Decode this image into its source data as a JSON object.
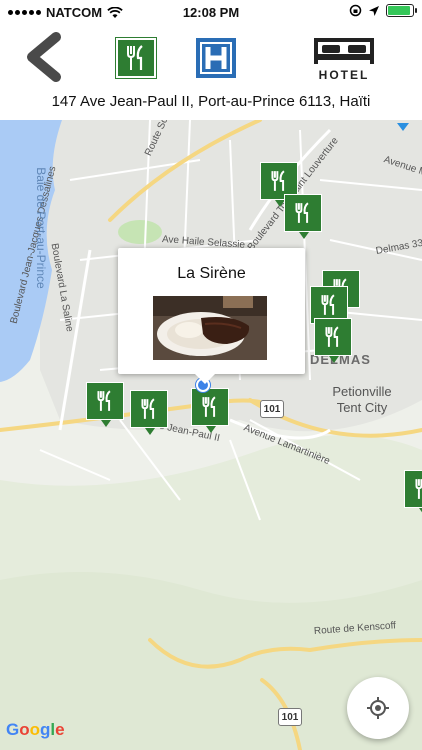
{
  "status_bar": {
    "carrier": "NATCOM",
    "time": "12:08 PM",
    "battery_level": 0.9
  },
  "nav": {
    "back_icon": "chevron-left-icon",
    "categories": [
      {
        "name": "restaurants",
        "icon": "fork-knife-icon",
        "color": "#2e7d32"
      },
      {
        "name": "hospitals",
        "icon": "hospital-h-icon",
        "color": "#2a6db5"
      },
      {
        "name": "hotels",
        "icon": "bed-icon",
        "label": "HOTEL"
      }
    ]
  },
  "address": "147 Ave Jean-Paul II, Port-au-Prince 6113, Haïti",
  "map": {
    "road_labels": [
      "Route Soleil",
      "Boulevard La Saline",
      "Boulevard Jean-Jacques Dessalines",
      "Ave Haile Selassie",
      "Boulevard Toussaint Louverture",
      "Avenue M",
      "Delmas 33",
      "Ave Jean-Paul II",
      "Avenue Lamartinière",
      "Route de Kenscoff"
    ],
    "place_labels": [
      "Baie de Port-au-Prince",
      "DELMAS",
      "Petionville Tent City"
    ],
    "route_shields": [
      "101",
      "101"
    ],
    "callout": {
      "title": "La Sirène",
      "photo": "restaurant-dish-photo"
    },
    "attribution": {
      "letters": [
        "G",
        "o",
        "o",
        "g",
        "l",
        "e"
      ],
      "colors": [
        "#4285F4",
        "#EA4335",
        "#FBBC05",
        "#4285F4",
        "#34A853",
        "#EA4335"
      ]
    }
  }
}
